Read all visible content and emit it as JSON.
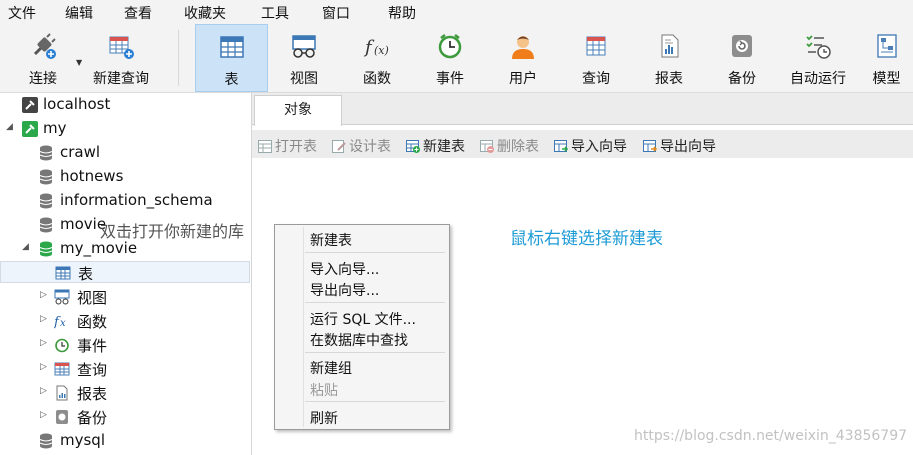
{
  "menu": [
    "文件",
    "编辑",
    "查看",
    "收藏夹",
    "工具",
    "窗口",
    "帮助"
  ],
  "toolbar": {
    "connect": "连接",
    "new_query": "新建查询",
    "buttons": [
      "表",
      "视图",
      "函数",
      "事件",
      "用户",
      "查询",
      "报表",
      "备份",
      "自动运行",
      "模型"
    ],
    "active_index": 0,
    "icons": [
      "plug-icon",
      "new-query-icon",
      "table-icon",
      "view-icon",
      "function-icon",
      "event-icon",
      "user-icon",
      "query-icon",
      "report-icon",
      "backup-icon",
      "automation-icon",
      "model-icon"
    ]
  },
  "tree": {
    "items": [
      {
        "label": "localhost",
        "icon": "connection-icon"
      },
      {
        "label": "my",
        "icon": "connection-icon"
      },
      {
        "label": "crawl",
        "icon": "database-icon"
      },
      {
        "label": "hotnews",
        "icon": "database-icon"
      },
      {
        "label": "information_schema",
        "icon": "database-icon"
      },
      {
        "label": "movie",
        "icon": "database-icon"
      },
      {
        "label": "my_movie",
        "icon": "database-open-icon"
      },
      {
        "label": "表",
        "icon": "table-icon"
      },
      {
        "label": "视图",
        "icon": "view-icon"
      },
      {
        "label": "函数",
        "icon": "function-icon"
      },
      {
        "label": "事件",
        "icon": "event-icon"
      },
      {
        "label": "查询",
        "icon": "query-icon"
      },
      {
        "label": "报表",
        "icon": "report-icon"
      },
      {
        "label": "备份",
        "icon": "backup-icon"
      },
      {
        "label": "mysql",
        "icon": "database-icon"
      }
    ],
    "selected": "表"
  },
  "tabs": {
    "objects": "对象"
  },
  "object_toolbar": {
    "open": "打开表",
    "design": "设计表",
    "new": "新建表",
    "delete": "删除表",
    "import": "导入向导",
    "export": "导出向导"
  },
  "annotations": {
    "right": "鼠标右键选择新建表",
    "left": "双击打开你新建的库"
  },
  "context_menu": {
    "items": [
      "新建表",
      "导入向导...",
      "导出向导...",
      "运行 SQL 文件...",
      "在数据库中查找",
      "新建组",
      "粘贴",
      "刷新"
    ],
    "disabled": [
      "粘贴"
    ]
  },
  "watermark": "https://blog.csdn.net/weixin_43856797",
  "colors": {
    "active_tab_bg": "#cce3f7",
    "hint_blue": "#1e9bd6",
    "db_green": "#2aa84a"
  }
}
